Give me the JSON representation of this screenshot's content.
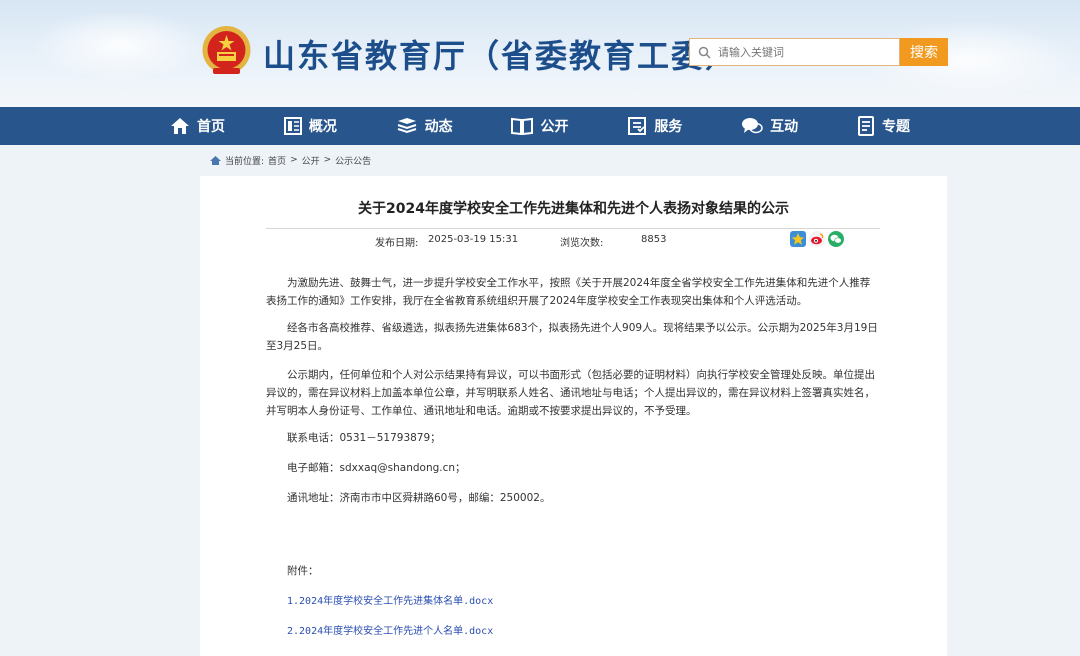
{
  "header": {
    "site_title": "山东省教育厅（省委教育工委）",
    "search_placeholder": "请输入关键词",
    "search_button": "搜索"
  },
  "nav": {
    "items": [
      {
        "label": "首页",
        "icon": "home-icon"
      },
      {
        "label": "概况",
        "icon": "overview-icon"
      },
      {
        "label": "动态",
        "icon": "news-icon"
      },
      {
        "label": "公开",
        "icon": "book-icon"
      },
      {
        "label": "服务",
        "icon": "service-icon"
      },
      {
        "label": "互动",
        "icon": "chat-icon"
      },
      {
        "label": "专题",
        "icon": "topic-icon"
      }
    ]
  },
  "breadcrumb": {
    "prefix": "当前位置:",
    "home": "首页",
    "sep1": ">",
    "level1": "公开",
    "sep2": ">",
    "level2": "公示公告"
  },
  "article": {
    "title": "关于2024年度学校安全工作先进集体和先进个人表扬对象结果的公示",
    "publish_label": "发布日期:",
    "publish_date": "2025-03-19 15:31",
    "views_label": "浏览次数:",
    "views": "8853",
    "paragraphs": [
      "为激励先进、鼓舞士气，进一步提升学校安全工作水平，按照《关于开展2024年度全省学校安全工作先进集体和先进个人推荐表扬工作的通知》工作安排，我厅在全省教育系统组织开展了2024年度学校安全工作表现突出集体和个人评选活动。",
      "经各市各高校推荐、省级遴选，拟表扬先进集体683个，拟表扬先进个人909人。现将结果予以公示。公示期为2025年3月19日至3月25日。",
      "公示期内，任何单位和个人对公示结果持有异议，可以书面形式（包括必要的证明材料）向执行学校安全管理处反映。单位提出异议的，需在异议材料上加盖本单位公章，并写明联系人姓名、通讯地址与电话；个人提出异议的，需在异议材料上签署真实姓名，并写明本人身份证号、工作单位、通讯地址和电话。逾期或不按要求提出异议的，不予受理。"
    ],
    "contact_phone": "联系电话：0531－51793879；",
    "contact_email": "电子邮箱：sdxxaq@shandong.cn；",
    "contact_address": "通讯地址：济南市市中区舜耕路60号，邮编：250002。",
    "attachments_label": "附件：",
    "attachments": [
      "1.2024年度学校安全工作先进集体名单.docx",
      "2.2024年度学校安全工作先进个人名单.docx"
    ]
  },
  "colors": {
    "nav_bg": "#27558c",
    "title_blue": "#1d4e8c",
    "search_orange": "#f19a1f",
    "link_blue": "#2b4fb3"
  }
}
